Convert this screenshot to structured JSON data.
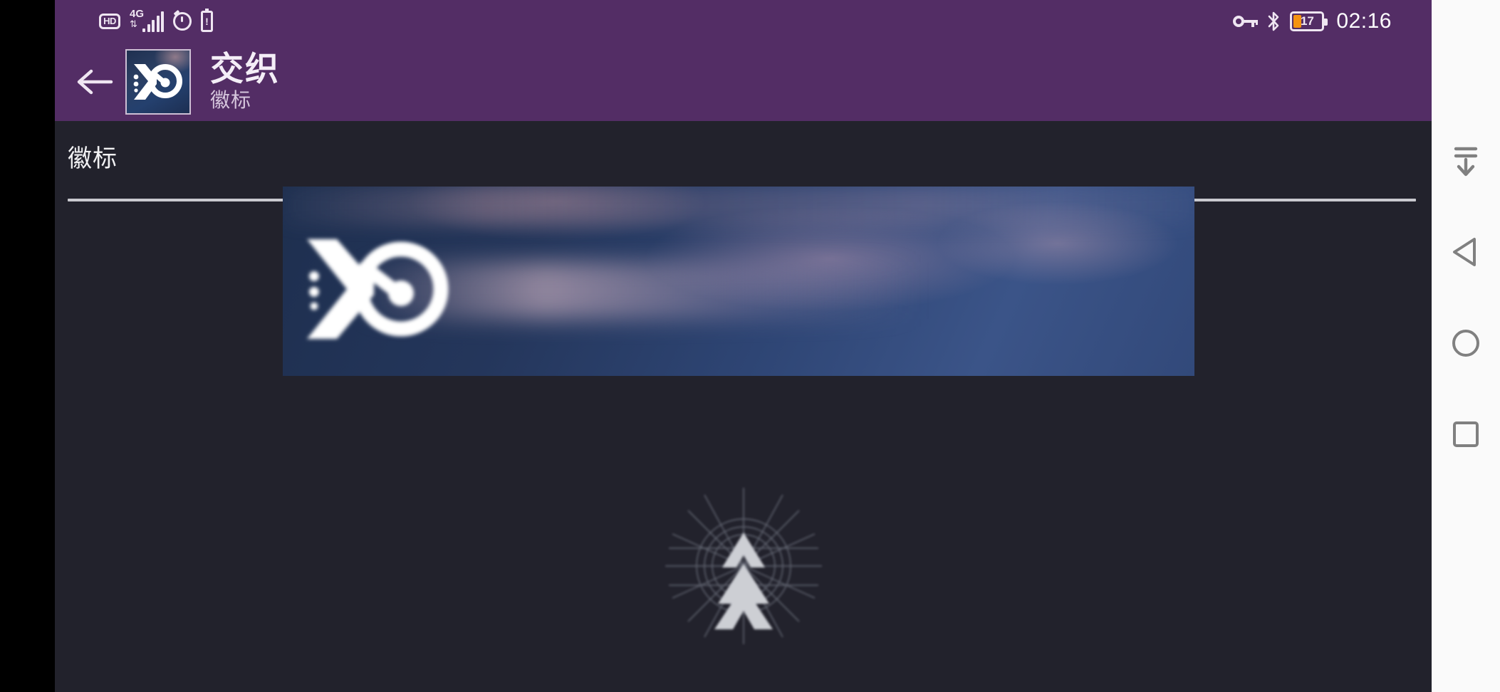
{
  "status_bar": {
    "hd_label": "HD",
    "network_label": "4G",
    "network_direction": "⇅",
    "signal_bars": 5,
    "alarm_icon": "alarm-icon",
    "battery_alert_icon": "battery-alert-icon",
    "battery_alert_glyph": "!",
    "key_icon": "key-icon",
    "bluetooth_icon": "bluetooth-icon",
    "battery_percent": "17",
    "time": "02:16"
  },
  "app_bar": {
    "back_icon": "back-arrow-icon",
    "thumbnail_name": "app-thumbnail",
    "title": "交织",
    "subtitle": "徽标"
  },
  "content": {
    "section_title": "徽标",
    "banner_name": "emblem-banner-image",
    "watermark_name": "watermark-logo"
  },
  "nav_bar": {
    "hide_label": "hide-navbar-icon",
    "back_label": "back-icon",
    "home_label": "home-icon",
    "recents_label": "recents-icon"
  },
  "colors": {
    "accent_purple": "#532d65",
    "background_dark": "#22222c",
    "battery_orange": "#f59311",
    "navbar_bg": "#fafafa",
    "navbar_icon": "#808080"
  }
}
